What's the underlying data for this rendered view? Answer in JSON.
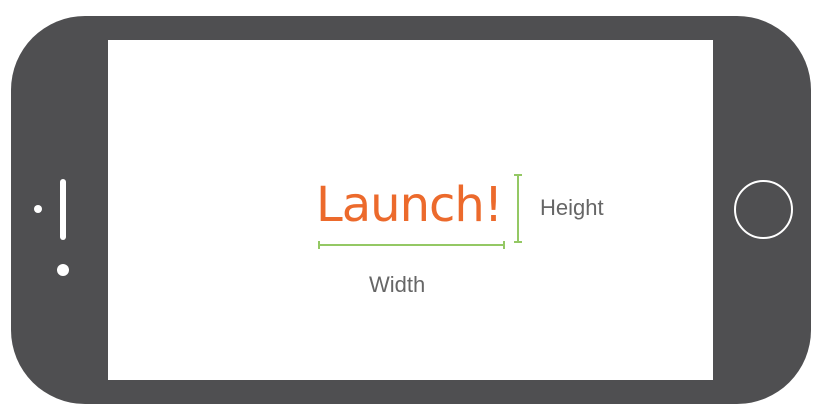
{
  "illustration": {
    "launch_label": "Launch!",
    "height_label": "Height",
    "width_label": "Width"
  },
  "colors": {
    "device_frame": "#4f4f51",
    "launch_text": "#ec6a2c",
    "dimension_lines": "#94c864",
    "dimension_labels": "#666666"
  }
}
